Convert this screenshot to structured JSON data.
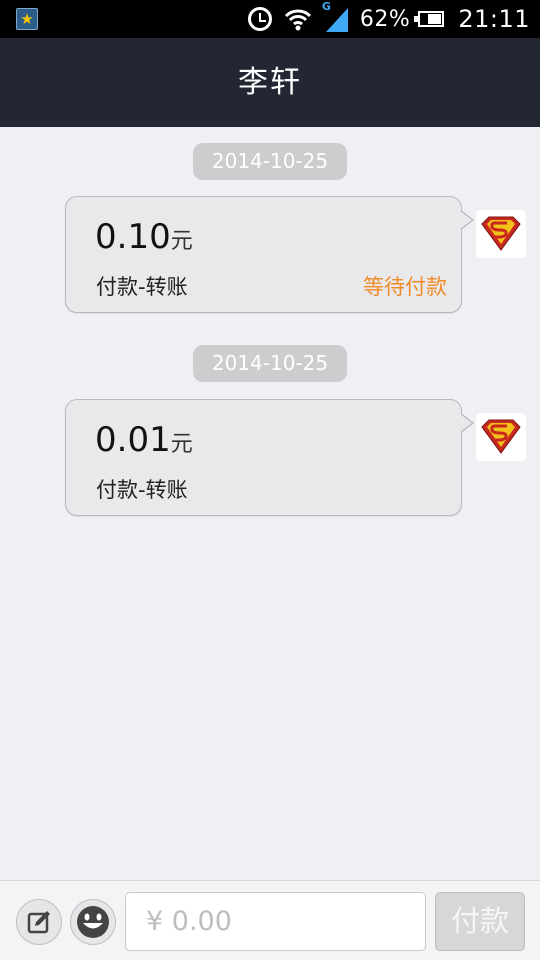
{
  "status_bar": {
    "battery_percent": "62%",
    "time": "21:11",
    "signal_label": "G",
    "icons": [
      "app-star-icon",
      "alarm-icon",
      "wifi-icon",
      "signal-icon",
      "battery-icon"
    ],
    "battery_level": 0.62
  },
  "header": {
    "title": "李轩"
  },
  "messages": [
    {
      "date": "2014-10-25",
      "amount": "0.10",
      "unit": "元",
      "description": "付款-转账",
      "status": "等待付款"
    },
    {
      "date": "2014-10-25",
      "amount": "0.01",
      "unit": "元",
      "description": "付款-转账",
      "status": ""
    }
  ],
  "input_bar": {
    "placeholder": "¥ 0.00",
    "pay_label": "付款"
  },
  "colors": {
    "header_bg": "#222733",
    "background": "#efeff4",
    "status_orange": "#f08c28",
    "bubble_bg": "#e9e9ec"
  }
}
